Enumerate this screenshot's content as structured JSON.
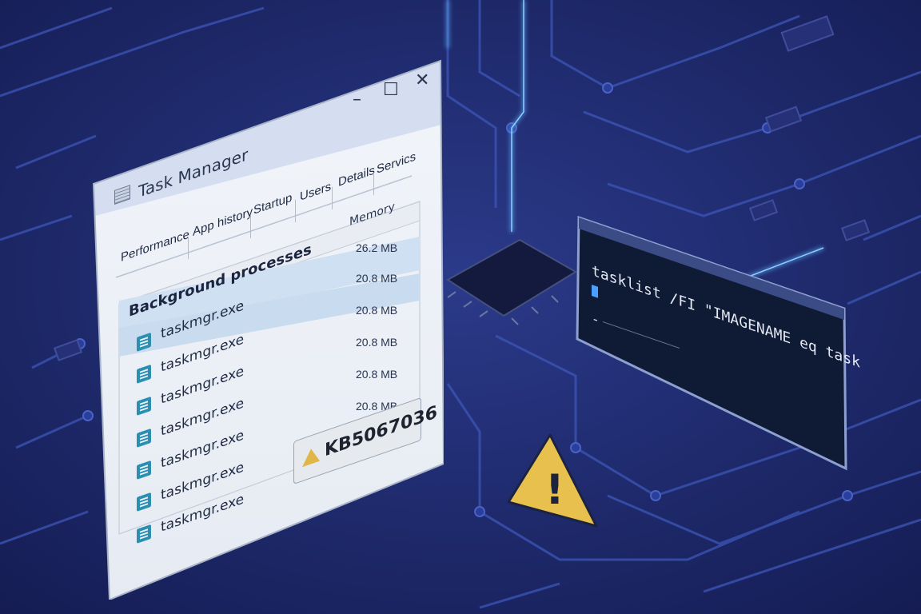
{
  "colors": {
    "background": "#1e2a6e",
    "circuit": "#3a56c8",
    "glow": "#4fa8ff",
    "warning": "#e8c04e"
  },
  "task_manager": {
    "title": "Task Manager",
    "icon": "task-manager-icon",
    "controls": {
      "minimize": "–",
      "maximize": "☐",
      "close": "✕"
    },
    "tabs": [
      {
        "label": "Performance"
      },
      {
        "label": "App history"
      },
      {
        "label": "Startup"
      },
      {
        "label": "Users"
      },
      {
        "label": "Details"
      },
      {
        "label": "Servics"
      }
    ],
    "columns": {
      "memory": "Memory"
    },
    "group": {
      "label": "Background processes",
      "memory": "26.2 MB"
    },
    "rows": [
      {
        "name": "taskmgr.exe",
        "memory": "20.8 MB",
        "selected": true
      },
      {
        "name": "taskmgr.exe",
        "memory": "20.8 MB"
      },
      {
        "name": "taskmgr.exe",
        "memory": "20.8 MB"
      },
      {
        "name": "taskmgr.exe",
        "memory": "20.8 MB"
      },
      {
        "name": "taskmgr.exe",
        "memory": "20.8 MB"
      },
      {
        "name": "taskmgr.exe",
        "memory": ""
      },
      {
        "name": "taskmgr.exe",
        "memory": ""
      }
    ],
    "badge": {
      "icon": "warning-icon",
      "label": "KB5067036"
    }
  },
  "terminal": {
    "command": "tasklist /FI \"IMAGENAME eq task",
    "prompt": "-"
  },
  "warning": {
    "icon": "warning-icon",
    "symbol": "!"
  }
}
